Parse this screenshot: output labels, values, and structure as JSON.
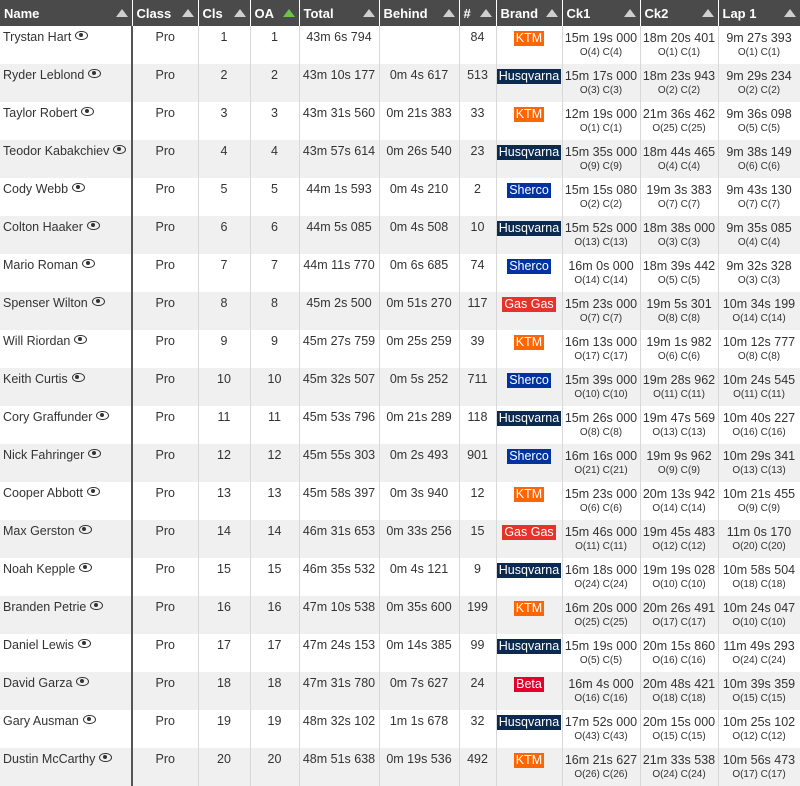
{
  "columns": [
    {
      "label": "Name",
      "sort": "none"
    },
    {
      "label": "Class",
      "sort": "none"
    },
    {
      "label": "Cls",
      "sort": "none"
    },
    {
      "label": "OA",
      "sort": "active"
    },
    {
      "label": "Total",
      "sort": "none"
    },
    {
      "label": "Behind",
      "sort": "none"
    },
    {
      "label": "#",
      "sort": "none"
    },
    {
      "label": "Brand",
      "sort": "none"
    },
    {
      "label": "Ck1",
      "sort": "none"
    },
    {
      "label": "Ck2",
      "sort": "none"
    },
    {
      "label": "Lap 1",
      "sort": "none"
    }
  ],
  "brand_colors": {
    "KTM": "#ff6600",
    "Husqvarna": "#0c2a4e",
    "Sherco": "#0033a0",
    "Gas Gas": "#e63329",
    "Beta": "#e4002b"
  },
  "rows": [
    {
      "name": "Trystan Hart",
      "class": "Pro",
      "cls": "1",
      "oa": "1",
      "total": "43m 6s 794",
      "behind": "",
      "num": "84",
      "brand": "KTM",
      "ck1": "15m 19s 000",
      "ck1_pos": "O(4) C(4)",
      "ck2": "18m 20s 401",
      "ck2_pos": "O(1) C(1)",
      "lap1": "9m 27s 393",
      "lap1_pos": "O(1) C(1)"
    },
    {
      "name": "Ryder Leblond",
      "class": "Pro",
      "cls": "2",
      "oa": "2",
      "total": "43m 10s 177",
      "behind": "0m 4s 617",
      "num": "513",
      "brand": "Husqvarna",
      "ck1": "15m 17s 000",
      "ck1_pos": "O(3) C(3)",
      "ck2": "18m 23s 943",
      "ck2_pos": "O(2) C(2)",
      "lap1": "9m 29s 234",
      "lap1_pos": "O(2) C(2)"
    },
    {
      "name": "Taylor Robert",
      "class": "Pro",
      "cls": "3",
      "oa": "3",
      "total": "43m 31s 560",
      "behind": "0m 21s 383",
      "num": "33",
      "brand": "KTM",
      "ck1": "12m 19s 000",
      "ck1_pos": "O(1) C(1)",
      "ck2": "21m 36s 462",
      "ck2_pos": "O(25) C(25)",
      "lap1": "9m 36s 098",
      "lap1_pos": "O(5) C(5)"
    },
    {
      "name": "Teodor Kabakchiev",
      "class": "Pro",
      "cls": "4",
      "oa": "4",
      "total": "43m 57s 614",
      "behind": "0m 26s 540",
      "num": "23",
      "brand": "Husqvarna",
      "ck1": "15m 35s 000",
      "ck1_pos": "O(9) C(9)",
      "ck2": "18m 44s 465",
      "ck2_pos": "O(4) C(4)",
      "lap1": "9m 38s 149",
      "lap1_pos": "O(6) C(6)"
    },
    {
      "name": "Cody Webb",
      "class": "Pro",
      "cls": "5",
      "oa": "5",
      "total": "44m 1s 593",
      "behind": "0m 4s 210",
      "num": "2",
      "brand": "Sherco",
      "ck1": "15m 15s 080",
      "ck1_pos": "O(2) C(2)",
      "ck2": "19m 3s 383",
      "ck2_pos": "O(7) C(7)",
      "lap1": "9m 43s 130",
      "lap1_pos": "O(7) C(7)"
    },
    {
      "name": "Colton Haaker",
      "class": "Pro",
      "cls": "6",
      "oa": "6",
      "total": "44m 5s 085",
      "behind": "0m 4s 508",
      "num": "10",
      "brand": "Husqvarna",
      "ck1": "15m 52s 000",
      "ck1_pos": "O(13) C(13)",
      "ck2": "18m 38s 000",
      "ck2_pos": "O(3) C(3)",
      "lap1": "9m 35s 085",
      "lap1_pos": "O(4) C(4)"
    },
    {
      "name": "Mario Roman",
      "class": "Pro",
      "cls": "7",
      "oa": "7",
      "total": "44m 11s 770",
      "behind": "0m 6s 685",
      "num": "74",
      "brand": "Sherco",
      "ck1": "16m 0s 000",
      "ck1_pos": "O(14) C(14)",
      "ck2": "18m 39s 442",
      "ck2_pos": "O(5) C(5)",
      "lap1": "9m 32s 328",
      "lap1_pos": "O(3) C(3)"
    },
    {
      "name": "Spenser Wilton",
      "class": "Pro",
      "cls": "8",
      "oa": "8",
      "total": "45m 2s 500",
      "behind": "0m 51s 270",
      "num": "117",
      "brand": "Gas Gas",
      "ck1": "15m 23s 000",
      "ck1_pos": "O(7) C(7)",
      "ck2": "19m 5s 301",
      "ck2_pos": "O(8) C(8)",
      "lap1": "10m 34s 199",
      "lap1_pos": "O(14) C(14)"
    },
    {
      "name": "Will Riordan",
      "class": "Pro",
      "cls": "9",
      "oa": "9",
      "total": "45m 27s 759",
      "behind": "0m 25s 259",
      "num": "39",
      "brand": "KTM",
      "ck1": "16m 13s 000",
      "ck1_pos": "O(17) C(17)",
      "ck2": "19m 1s 982",
      "ck2_pos": "O(6) C(6)",
      "lap1": "10m 12s 777",
      "lap1_pos": "O(8) C(8)"
    },
    {
      "name": "Keith Curtis",
      "class": "Pro",
      "cls": "10",
      "oa": "10",
      "total": "45m 32s 507",
      "behind": "0m 5s 252",
      "num": "711",
      "brand": "Sherco",
      "ck1": "15m 39s 000",
      "ck1_pos": "O(10) C(10)",
      "ck2": "19m 28s 962",
      "ck2_pos": "O(11) C(11)",
      "lap1": "10m 24s 545",
      "lap1_pos": "O(11) C(11)"
    },
    {
      "name": "Cory Graffunder",
      "class": "Pro",
      "cls": "11",
      "oa": "11",
      "total": "45m 53s 796",
      "behind": "0m 21s 289",
      "num": "118",
      "brand": "Husqvarna",
      "ck1": "15m 26s 000",
      "ck1_pos": "O(8) C(8)",
      "ck2": "19m 47s 569",
      "ck2_pos": "O(13) C(13)",
      "lap1": "10m 40s 227",
      "lap1_pos": "O(16) C(16)"
    },
    {
      "name": "Nick Fahringer",
      "class": "Pro",
      "cls": "12",
      "oa": "12",
      "total": "45m 55s 303",
      "behind": "0m 2s 493",
      "num": "901",
      "brand": "Sherco",
      "ck1": "16m 16s 000",
      "ck1_pos": "O(21) C(21)",
      "ck2": "19m 9s 962",
      "ck2_pos": "O(9) C(9)",
      "lap1": "10m 29s 341",
      "lap1_pos": "O(13) C(13)"
    },
    {
      "name": "Cooper Abbott",
      "class": "Pro",
      "cls": "13",
      "oa": "13",
      "total": "45m 58s 397",
      "behind": "0m 3s 940",
      "num": "12",
      "brand": "KTM",
      "ck1": "15m 23s 000",
      "ck1_pos": "O(6) C(6)",
      "ck2": "20m 13s 942",
      "ck2_pos": "O(14) C(14)",
      "lap1": "10m 21s 455",
      "lap1_pos": "O(9) C(9)"
    },
    {
      "name": "Max Gerston",
      "class": "Pro",
      "cls": "14",
      "oa": "14",
      "total": "46m 31s 653",
      "behind": "0m 33s 256",
      "num": "15",
      "brand": "Gas Gas",
      "ck1": "15m 46s 000",
      "ck1_pos": "O(11) C(11)",
      "ck2": "19m 45s 483",
      "ck2_pos": "O(12) C(12)",
      "lap1": "11m 0s 170",
      "lap1_pos": "O(20) C(20)"
    },
    {
      "name": "Noah Kepple",
      "class": "Pro",
      "cls": "15",
      "oa": "15",
      "total": "46m 35s 532",
      "behind": "0m 4s 121",
      "num": "9",
      "brand": "Husqvarna",
      "ck1": "16m 18s 000",
      "ck1_pos": "O(24) C(24)",
      "ck2": "19m 19s 028",
      "ck2_pos": "O(10) C(10)",
      "lap1": "10m 58s 504",
      "lap1_pos": "O(18) C(18)"
    },
    {
      "name": "Branden Petrie",
      "class": "Pro",
      "cls": "16",
      "oa": "16",
      "total": "47m 10s 538",
      "behind": "0m 35s 600",
      "num": "199",
      "brand": "KTM",
      "ck1": "16m 20s 000",
      "ck1_pos": "O(25) C(25)",
      "ck2": "20m 26s 491",
      "ck2_pos": "O(17) C(17)",
      "lap1": "10m 24s 047",
      "lap1_pos": "O(10) C(10)"
    },
    {
      "name": "Daniel Lewis",
      "class": "Pro",
      "cls": "17",
      "oa": "17",
      "total": "47m 24s 153",
      "behind": "0m 14s 385",
      "num": "99",
      "brand": "Husqvarna",
      "ck1": "15m 19s 000",
      "ck1_pos": "O(5) C(5)",
      "ck2": "20m 15s 860",
      "ck2_pos": "O(16) C(16)",
      "lap1": "11m 49s 293",
      "lap1_pos": "O(24) C(24)"
    },
    {
      "name": "David Garza",
      "class": "Pro",
      "cls": "18",
      "oa": "18",
      "total": "47m 31s 780",
      "behind": "0m 7s 627",
      "num": "24",
      "brand": "Beta",
      "ck1": "16m 4s 000",
      "ck1_pos": "O(16) C(16)",
      "ck2": "20m 48s 421",
      "ck2_pos": "O(18) C(18)",
      "lap1": "10m 39s 359",
      "lap1_pos": "O(15) C(15)"
    },
    {
      "name": "Gary Ausman",
      "class": "Pro",
      "cls": "19",
      "oa": "19",
      "total": "48m 32s 102",
      "behind": "1m 1s 678",
      "num": "32",
      "brand": "Husqvarna",
      "ck1": "17m 52s 000",
      "ck1_pos": "O(43) C(43)",
      "ck2": "20m 15s 000",
      "ck2_pos": "O(15) C(15)",
      "lap1": "10m 25s 102",
      "lap1_pos": "O(12) C(12)"
    },
    {
      "name": "Dustin McCarthy",
      "class": "Pro",
      "cls": "20",
      "oa": "20",
      "total": "48m 51s 638",
      "behind": "0m 19s 536",
      "num": "492",
      "brand": "KTM",
      "ck1": "16m 21s 627",
      "ck1_pos": "O(26) C(26)",
      "ck2": "21m 33s 538",
      "ck2_pos": "O(24) C(24)",
      "lap1": "10m 56s 473",
      "lap1_pos": "O(17) C(17)"
    }
  ]
}
